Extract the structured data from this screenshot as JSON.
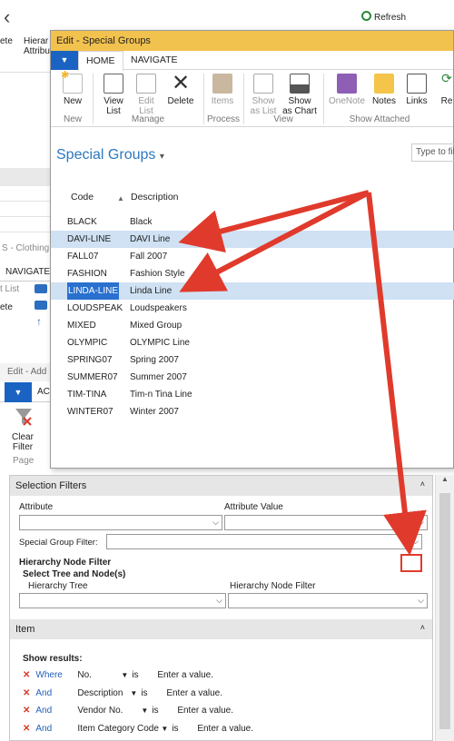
{
  "bg_window": {
    "ribbon_labels": [
      "ete",
      "Hierar",
      "Attribu",
      "Refresh"
    ],
    "side_title": "S - Clothing",
    "side_tab": "NAVIGATE",
    "side_items": [
      "t List",
      "ete"
    ],
    "side2_title": "Edit - Add",
    "side2_tab": "AC",
    "clear_filter": "Clear Filter",
    "page_group": "Page"
  },
  "dialog": {
    "title": "Edit - Special Groups",
    "tabs": [
      "HOME",
      "NAVIGATE"
    ],
    "ribbon": {
      "new": "New",
      "view_list": "View List",
      "edit_list": "Edit List",
      "delete": "Delete",
      "items": "Items",
      "show_as_list": "Show as List",
      "show_as_chart": "Show as Chart",
      "onenote": "OneNote",
      "notes": "Notes",
      "links": "Links",
      "re": "Re"
    },
    "groups": {
      "new": "New",
      "manage": "Manage",
      "process": "Process",
      "view": "View",
      "show_attached": "Show Attached"
    },
    "page_title": "Special Groups",
    "filter_placeholder": "Type to fil",
    "columns": {
      "code": "Code",
      "description": "Description"
    },
    "rows": [
      {
        "code": "BLACK",
        "description": "Black"
      },
      {
        "code": "DAVI-LINE",
        "description": "DAVI Line"
      },
      {
        "code": "FALL07",
        "description": "Fall 2007"
      },
      {
        "code": "FASHION",
        "description": "Fashion Style"
      },
      {
        "code": "LINDA-LINE",
        "description": "Linda Line"
      },
      {
        "code": "LOUDSPEAK",
        "description": "Loudspeakers"
      },
      {
        "code": "MIXED",
        "description": "Mixed Group"
      },
      {
        "code": "OLYMPIC",
        "description": "OLYMPIC Line"
      },
      {
        "code": "SPRING07",
        "description": "Spring 2007"
      },
      {
        "code": "SUMMER07",
        "description": "Summer 2007"
      },
      {
        "code": "TIM-TINA",
        "description": "Tim-n Tina Line"
      },
      {
        "code": "WINTER07",
        "description": "Winter 2007"
      }
    ]
  },
  "filters": {
    "header": "Selection Filters",
    "attribute": "Attribute",
    "attribute_value": "Attribute Value",
    "special_group_filter": "Special Group Filter:",
    "hierarchy_node_filter_title": "Hierarchy Node Filter",
    "select_tree": "Select Tree and Node(s)",
    "hierarchy_tree": "Hierarchy Tree",
    "hierarchy_node_filter": "Hierarchy Node Filter",
    "item_header": "Item",
    "show_results": "Show results:",
    "conditions": [
      {
        "op": "Where",
        "field": "No.",
        "is": "is",
        "value": "Enter a value."
      },
      {
        "op": "And",
        "field": "Description",
        "is": "is",
        "value": "Enter a value."
      },
      {
        "op": "And",
        "field": "Vendor No.",
        "is": "is",
        "value": "Enter a value."
      },
      {
        "op": "And",
        "field": "Item Category Code",
        "is": "is",
        "value": "Enter a value."
      }
    ]
  },
  "colors": {
    "accent": "#1a63c2",
    "title_bar": "#f2c24e",
    "arrow": "#e03a2c",
    "link": "#2c78c0"
  }
}
